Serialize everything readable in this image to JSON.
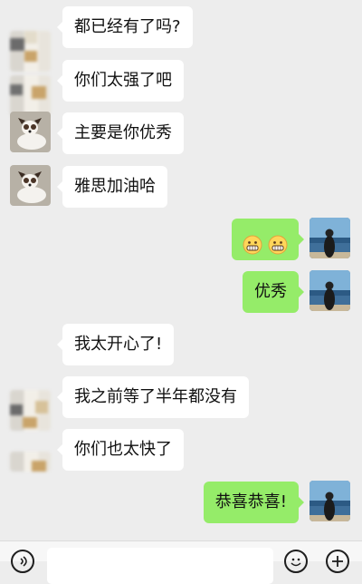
{
  "messages": [
    {
      "side": "in",
      "text": "都已经有了吗?"
    },
    {
      "side": "in",
      "text": "你们太强了吧"
    },
    {
      "side": "in",
      "text": "主要是你优秀"
    },
    {
      "side": "in",
      "text": "雅思加油哈"
    },
    {
      "side": "out",
      "emoji": [
        "grinning-face",
        "grinning-face"
      ]
    },
    {
      "side": "out",
      "text": "优秀"
    },
    {
      "side": "in",
      "text": "我太开心了!"
    },
    {
      "side": "in",
      "text": "我之前等了半年都没有"
    },
    {
      "side": "in",
      "text": "你们也太快了"
    },
    {
      "side": "out",
      "text": "恭喜恭喜!"
    }
  ],
  "colors": {
    "background": "#ededed",
    "incoming_bubble": "#ffffff",
    "outgoing_bubble": "#95ec69"
  },
  "icons": {
    "left": "voice-icon",
    "right1": "emoji-icon",
    "right2": "plus-icon"
  }
}
